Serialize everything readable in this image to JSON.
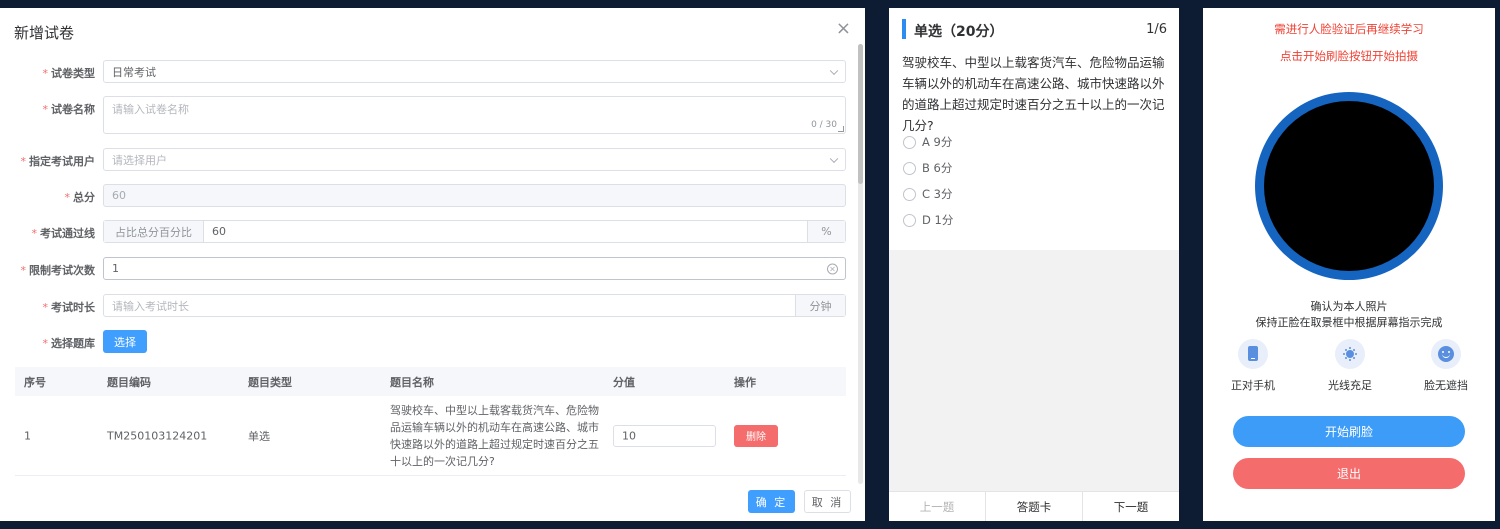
{
  "dialog": {
    "title": "新增试卷",
    "close_glyph": "×",
    "required_mark": "*",
    "fields": {
      "type": {
        "label": "试卷类型",
        "value": "日常考试"
      },
      "name": {
        "label": "试卷名称",
        "placeholder": "请输入试卷名称",
        "counter": "0 / 30"
      },
      "users": {
        "label": "指定考试用户",
        "placeholder": "请选择用户"
      },
      "total": {
        "label": "总分",
        "value": "60"
      },
      "pass": {
        "label": "考试通过线",
        "prepend": "占比总分百分比",
        "value": "60",
        "append": "%"
      },
      "attempts": {
        "label": "限制考试次数",
        "value": "1"
      },
      "duration": {
        "label": "考试时长",
        "placeholder": "请输入考试时长",
        "append": "分钟"
      },
      "bank": {
        "label": "选择题库",
        "button": "选择"
      }
    },
    "table": {
      "headers": [
        "序号",
        "题目编码",
        "题目类型",
        "题目名称",
        "分值",
        "操作"
      ],
      "rows": [
        {
          "index": "1",
          "code": "TM250103124201",
          "type": "单选",
          "name": "驾驶校车、中型以上载客载货汽车、危险物品运输车辆以外的机动车在高速公路、城市快速路以外的道路上超过规定时速百分之五十以上的一次记几分?",
          "score": "10",
          "action": "删除"
        }
      ]
    },
    "confirm": "确 定",
    "cancel": "取 消"
  },
  "question": {
    "heading": "单选（20分）",
    "counter": "1/6",
    "text": "驾驶校车、中型以上载客货汽车、危险物品运输车辆以外的机动车在高速公路、城市快速路以外的道路上超过规定时速百分之五十以上的一次记几分?",
    "options": [
      "A 9分",
      "B 6分",
      "C 3分",
      "D 1分"
    ],
    "footer": {
      "prev": "上一题",
      "card": "答题卡",
      "next": "下一题"
    },
    "accent": "#2d8cf0"
  },
  "face": {
    "warning1": "需进行人脸验证后再继续学习",
    "warning2": "点击开始刷脸按钮开始拍摄",
    "progress": 1.0,
    "confirm_line1": "确认为本人照片",
    "confirm_line2": "保持正脸在取景框中根据屏幕指示完成",
    "tips": [
      {
        "icon": "phone-icon",
        "label": "正对手机"
      },
      {
        "icon": "sun-icon",
        "label": "光线充足"
      },
      {
        "icon": "smile-face-icon",
        "label": "脸无遮挡"
      }
    ],
    "start_button": "开始刷脸",
    "exit_button": "退出",
    "colors": {
      "start": "#3c9cf8",
      "exit": "#f56c6c",
      "warning": "#f04134",
      "ring": "#1565c0"
    }
  }
}
